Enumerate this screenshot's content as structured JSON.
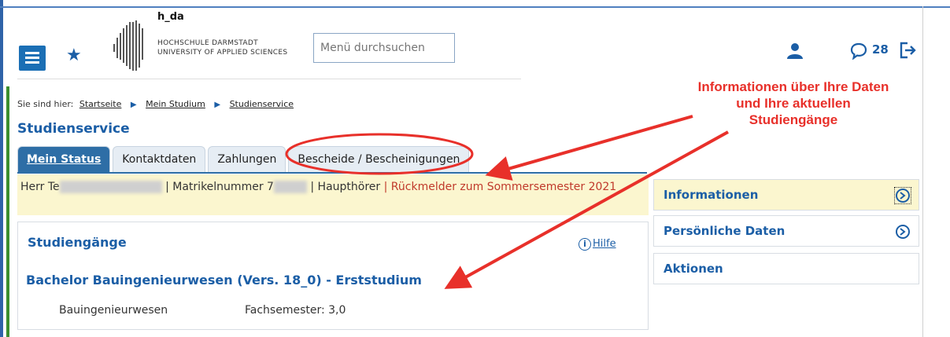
{
  "header": {
    "logo_name": "h_da",
    "logo_line1": "HOCHSCHULE DARMSTADT",
    "logo_line2": "UNIVERSITY OF APPLIED SCIENCES",
    "search_placeholder": "Menü durchsuchen",
    "message_count": "28"
  },
  "breadcrumb": {
    "prefix": "Sie sind hier:",
    "items": [
      "Startseite",
      "Mein Studium",
      "Studienservice"
    ]
  },
  "page_title": "Studienservice",
  "tabs": [
    {
      "label": "Mein Status",
      "active": true
    },
    {
      "label": "Kontaktdaten",
      "active": false
    },
    {
      "label": "Zahlungen",
      "active": false
    },
    {
      "label": "Bescheide / Bescheinigungen",
      "active": false
    }
  ],
  "status": {
    "salutation": "Herr Te",
    "matrikel": "| Matrikelnummer 7",
    "hoerer": "| Haupthörer",
    "rueckmelder": "| Rückmelder zum Sommersemester 2021"
  },
  "studies": {
    "title": "Studiengänge",
    "help": "Hilfe",
    "degree": "Bachelor Bauingenieurwesen (Vers. 18_0) - Erststudium",
    "subject": "Bauingenieurwesen",
    "semester": "Fachsemester: 3,0"
  },
  "sidebar": {
    "items": [
      "Informationen",
      "Persönliche Daten",
      "Aktionen"
    ]
  },
  "annotation": {
    "text": "Informationen über Ihre Daten und Ihre aktuellen Studiengänge"
  },
  "colors": {
    "primary": "#1b5ea6",
    "highlight": "#fbf6cf",
    "annotation": "#e8302a"
  }
}
